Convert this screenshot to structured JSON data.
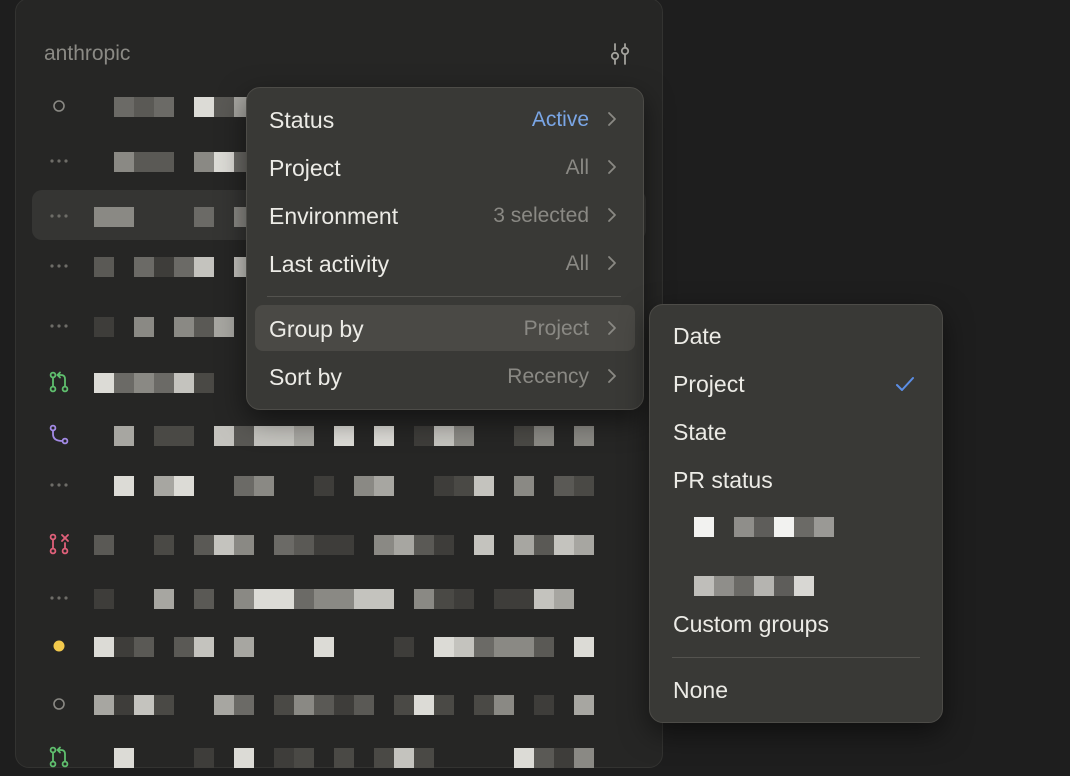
{
  "sidebar": {
    "title": "anthropic",
    "filter_icon": "sliders-icon",
    "rows": [
      {
        "icon": "circle-outline-icon"
      },
      {
        "icon": "ellipsis-icon"
      },
      {
        "icon": "ellipsis-icon"
      },
      {
        "icon": "ellipsis-icon"
      },
      {
        "icon": "ellipsis-icon"
      },
      {
        "icon": "pull-request-icon"
      },
      {
        "icon": "merged-icon"
      },
      {
        "icon": "ellipsis-icon"
      },
      {
        "icon": "pull-request-closed-icon"
      },
      {
        "icon": "ellipsis-icon"
      },
      {
        "icon": "yellow-dot-icon"
      },
      {
        "icon": "circle-outline-icon"
      },
      {
        "icon": "pull-request-icon"
      }
    ]
  },
  "filter_menu": {
    "items": [
      {
        "label": "Status",
        "value": "Active"
      },
      {
        "label": "Project",
        "value": "All"
      },
      {
        "label": "Environment",
        "value": "3 selected"
      },
      {
        "label": "Last activity",
        "value": "All"
      },
      {
        "label": "Group by",
        "value": "Project"
      },
      {
        "label": "Sort by",
        "value": "Recency"
      }
    ]
  },
  "group_submenu": {
    "items": [
      {
        "label": "Date"
      },
      {
        "label": "Project",
        "selected": true
      },
      {
        "label": "State"
      },
      {
        "label": "PR status"
      },
      {
        "label": "Custom groups"
      },
      {
        "label": "None"
      }
    ]
  },
  "colors": {
    "accent": "#7aa6e6",
    "checkmark": "#5b8ee6",
    "pr_open": "#5fbf6e",
    "pr_merged": "#a38ae6",
    "pr_closed": "#e0607a",
    "status_yellow": "#f2c94c"
  }
}
